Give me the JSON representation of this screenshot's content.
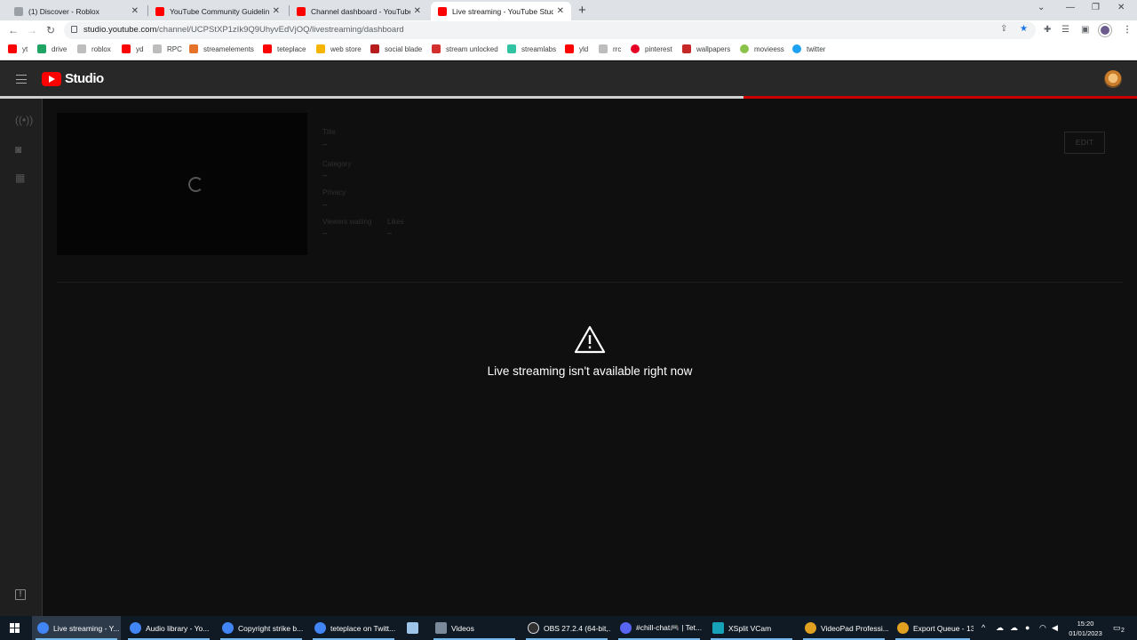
{
  "browser": {
    "tabs": [
      {
        "title": "(1) Discover - Roblox",
        "close": "x",
        "icon_color": "#9aa0a6"
      },
      {
        "title": "YouTube Community Guidelines",
        "close": "x",
        "icon_color": "#ff0000"
      },
      {
        "title": "Channel dashboard - YouTube Studio",
        "close": "x",
        "icon_color": "#ff0000"
      },
      {
        "title": "Live streaming - YouTube Studio",
        "close": "x",
        "icon_color": "#ff0000"
      }
    ],
    "new_tab": "+",
    "url_host": "studio.youtube.com",
    "url_path": "/channel/UCPStXP1zIk9Q9UhyvEdVjOQ/livestreaming/dashboard",
    "bookmarks": [
      {
        "label": "yt",
        "color": "#ff0000"
      },
      {
        "label": "drive",
        "color": "#1fa463"
      },
      {
        "label": "roblox",
        "color": "#bdbdbd"
      },
      {
        "label": "yd",
        "color": "#ff0000"
      },
      {
        "label": "RPC",
        "color": "#bdbdbd"
      },
      {
        "label": "streamelements",
        "color": "#e5732a"
      },
      {
        "label": "teteplace",
        "color": "#ff0000"
      },
      {
        "label": "web store",
        "color": "#f4b400"
      },
      {
        "label": "social blade",
        "color": "#b71c1c"
      },
      {
        "label": "stream unlocked",
        "color": "#d32f2f"
      },
      {
        "label": "streamlabs",
        "color": "#31c3a2"
      },
      {
        "label": "yld",
        "color": "#ff0000"
      },
      {
        "label": "rrc",
        "color": "#bdbdbd"
      },
      {
        "label": "pinterest",
        "color": "#e60023"
      },
      {
        "label": "wallpapers",
        "color": "#c62828"
      },
      {
        "label": "movieess",
        "color": "#8bc34a"
      },
      {
        "label": "twitter",
        "color": "#1da1f2"
      }
    ]
  },
  "studio": {
    "brand": "Studio",
    "progress_fraction": 0.654,
    "stream_meta": {
      "title_label": "Title",
      "title_value": "--",
      "category_label": "Category",
      "category_value": "--",
      "privacy_label": "Privacy",
      "privacy_value": "--",
      "viewers_label": "Viewers waiting",
      "viewers_value": "--",
      "likes_label": "Likes",
      "likes_value": "--"
    },
    "edit_button": "EDIT",
    "error_message": "Live streaming isn't available right now"
  },
  "taskbar": {
    "items": [
      {
        "label": "Live streaming - Y...",
        "icon_color": "#4285f4"
      },
      {
        "label": "Audio library - Yo...",
        "icon_color": "#4285f4"
      },
      {
        "label": "Copyright strike b...",
        "icon_color": "#4285f4"
      },
      {
        "label": "teteplace on Twitt...",
        "icon_color": "#4285f4"
      },
      {
        "label": "",
        "icon_color": "#9ec5e8"
      },
      {
        "label": "Videos",
        "icon_color": "#7a8a9a"
      },
      {
        "label": "OBS 27.2.4 (64-bit,...",
        "icon_color": "#303030"
      },
      {
        "label": "#chill-chat🎮 | Tet...",
        "icon_color": "#5865f2"
      },
      {
        "label": "XSplit VCam",
        "icon_color": "#17a2b8"
      },
      {
        "label": "VideoPad Professi...",
        "icon_color": "#e0a020"
      },
      {
        "label": "Export Queue - 13...",
        "icon_color": "#e0a020"
      }
    ],
    "time": "15:20",
    "date": "01/01/2023",
    "notifications": "2"
  }
}
